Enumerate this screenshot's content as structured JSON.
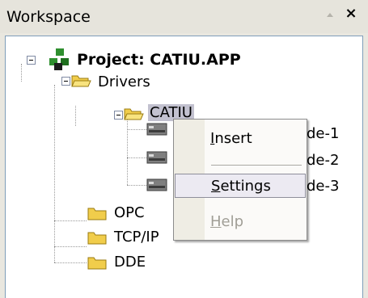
{
  "window": {
    "title": "Workspace"
  },
  "tree": {
    "project_label": "Project: CATIU.APP",
    "drivers_label": "Drivers",
    "driver_name": "CATIU",
    "nodes": [
      "de-1",
      "de-2",
      "de-3"
    ],
    "folders": [
      "OPC",
      "TCP/IP",
      "DDE"
    ]
  },
  "context_menu": {
    "items": [
      {
        "label": "Insert",
        "state": "normal"
      },
      {
        "label": "Settings",
        "state": "highlighted"
      },
      {
        "label": "Help",
        "state": "disabled"
      }
    ]
  },
  "colors": {
    "selection": "#c2c1cf",
    "folder_fill": "#f1cd4b",
    "menu_highlight": "#eceaf2",
    "tree_background": "#ffffff"
  }
}
